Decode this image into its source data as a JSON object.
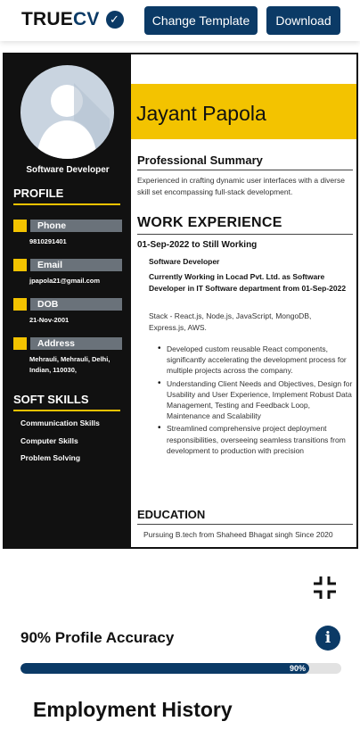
{
  "header": {
    "logo_text_a": "TRUE",
    "logo_text_b": "CV",
    "change_template_label": "Change Template",
    "download_label": "Download"
  },
  "resume": {
    "sidebar": {
      "role": "Software Developer",
      "profile_heading": "PROFILE",
      "contacts": [
        {
          "label": "Phone",
          "value": "9810291401"
        },
        {
          "label": "Email",
          "value": "jpapola21@gmail.com"
        },
        {
          "label": "DOB",
          "value": "21-Nov-2001"
        },
        {
          "label": "Address",
          "value": "Mehrauli, Mehrauli, Delhi, Indian, 110030,"
        }
      ],
      "soft_skills_heading": "SOFT SKILLS",
      "soft_skills": [
        "Communication Skills",
        "Computer Skills",
        "Problem Solving"
      ]
    },
    "name": "Jayant Papola",
    "summary_heading": "Professional Summary",
    "summary_text": "Experienced in crafting dynamic user interfaces with a diverse skill set encompassing full-stack development.",
    "work_heading": "WORK EXPERIENCE",
    "work": {
      "period": "01-Sep-2022 to Still Working",
      "title": "Software Developer",
      "description": "Currently Working in Locad Pvt. Ltd. as Software Developer in IT Software department from 01-Sep-2022",
      "stack": "Stack - React.js, Node.js, JavaScript, MongoDB, Express.js, AWS.",
      "bullets": [
        "Developed custom reusable React components, significantly accelerating the development process for multiple projects across the company.",
        "Understanding Client Needs and Objectives, Design for Usability and User Experience, Implement Robust Data Management, Testing and Feedback Loop, Maintenance and Scalability",
        "Streamlined comprehensive project deployment responsibilities, overseeing seamless transitions from development to production with precision"
      ]
    },
    "education_heading": "EDUCATION",
    "education_text": "Pursuing B.tech from Shaheed Bhagat singh Since 2020"
  },
  "accuracy": {
    "label": "90% Profile Accuracy",
    "percent": 90,
    "bar_text": "90%"
  },
  "section_heading": "Employment History",
  "colors": {
    "navy": "#0b3a66",
    "yellow": "#f3c300",
    "sidebar_bg": "#111111"
  },
  "icons": {
    "logo_check": "check-icon",
    "collapse": "collapse-icon",
    "info": "info-icon",
    "avatar": "user-silhouette-icon"
  }
}
